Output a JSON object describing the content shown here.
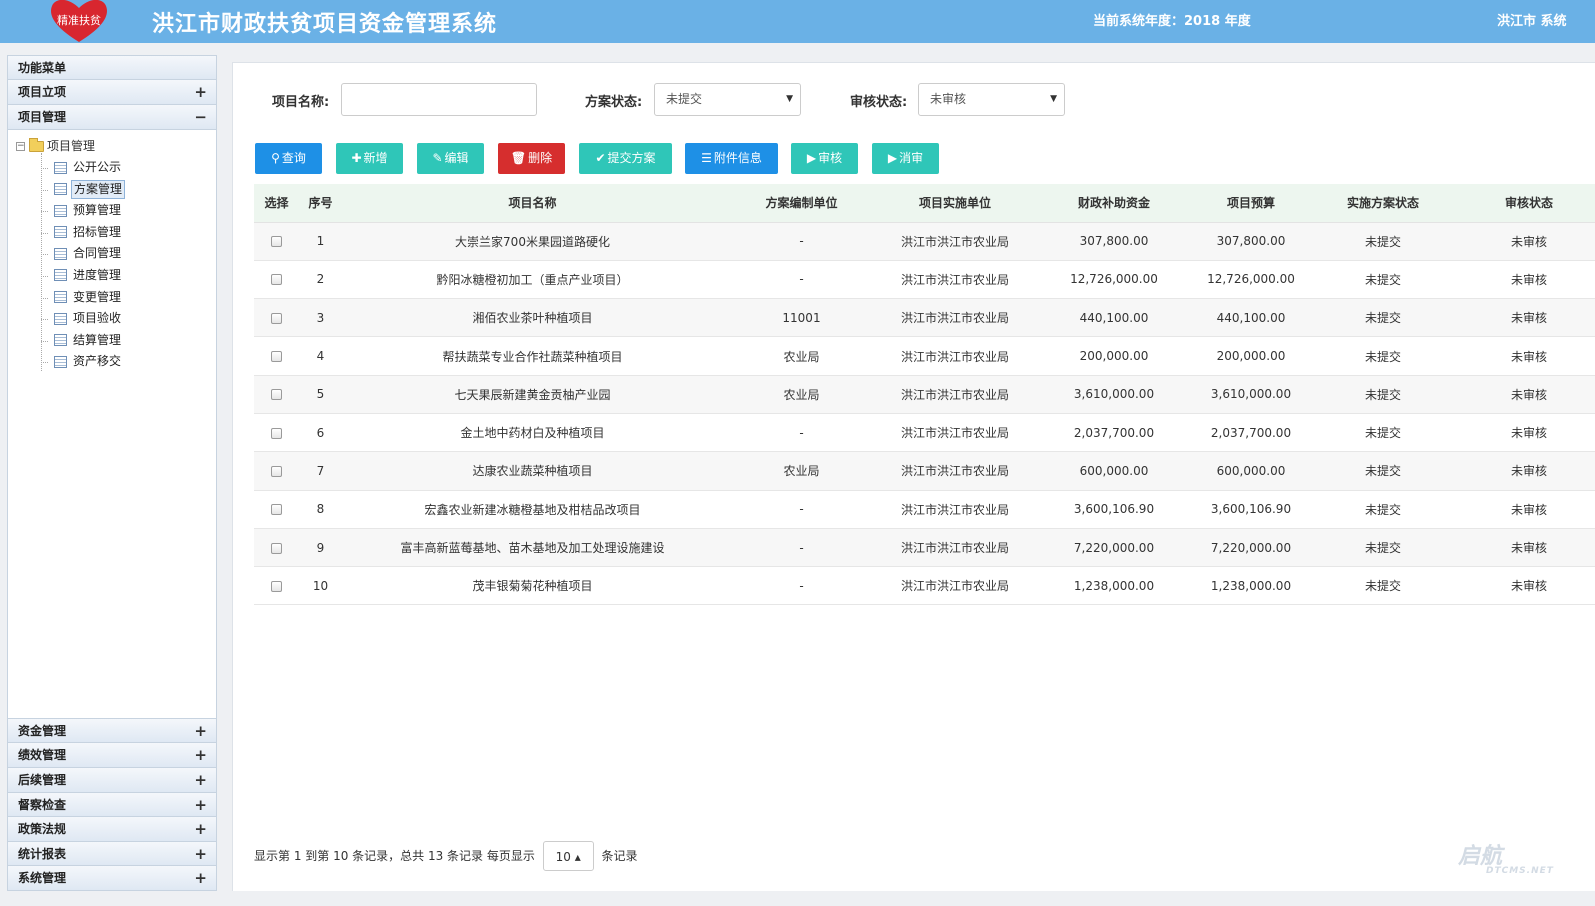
{
  "header": {
    "logo_text": "精准扶贫",
    "title": "洪江市财政扶贫项目资金管理系统",
    "year_info": "当前系统年度：2018 年度",
    "user_info": "洪江市 系统"
  },
  "sidebar": {
    "menu_title": "功能菜单",
    "top_groups": [
      {
        "label": "项目立项",
        "sign": "+"
      },
      {
        "label": "项目管理",
        "sign": "−"
      }
    ],
    "tree_root": "项目管理",
    "tree_items": [
      "公开公示",
      "方案管理",
      "预算管理",
      "招标管理",
      "合同管理",
      "进度管理",
      "变更管理",
      "项目验收",
      "结算管理",
      "资产移交"
    ],
    "selected_item": "方案管理",
    "bottom_groups": [
      {
        "label": "资金管理",
        "sign": "+"
      },
      {
        "label": "绩效管理",
        "sign": "+"
      },
      {
        "label": "后续管理",
        "sign": "+"
      },
      {
        "label": "督察检查",
        "sign": "+"
      },
      {
        "label": "政策法规",
        "sign": "+"
      },
      {
        "label": "统计报表",
        "sign": "+"
      },
      {
        "label": "系统管理",
        "sign": "+"
      }
    ]
  },
  "filters": {
    "name_label": "项目名称:",
    "name_value": "",
    "plan_status_label": "方案状态:",
    "plan_status_value": "未提交",
    "audit_status_label": "审核状态:",
    "audit_status_value": "未审核"
  },
  "toolbar": {
    "query": "查询",
    "add": "新增",
    "edit": "编辑",
    "delete": "删除",
    "submit_plan": "提交方案",
    "attachments": "附件信息",
    "audit": "审核",
    "cancel_audit": "消审"
  },
  "table": {
    "headers": [
      "选择",
      "序号",
      "项目名称",
      "方案编制单位",
      "项目实施单位",
      "财政补助资金",
      "项目预算",
      "实施方案状态",
      "审核状态"
    ],
    "rows": [
      {
        "no": "1",
        "name": "大崇兰家700米果园道路硬化",
        "plan_unit": "-",
        "impl_unit": "洪江市洪江市农业局",
        "subsidy": "307,800.00",
        "budget": "307,800.00",
        "plan_status": "未提交",
        "audit_status": "未审核"
      },
      {
        "no": "2",
        "name": "黔阳冰糖橙初加工（重点产业项目）",
        "plan_unit": "-",
        "impl_unit": "洪江市洪江市农业局",
        "subsidy": "12,726,000.00",
        "budget": "12,726,000.00",
        "plan_status": "未提交",
        "audit_status": "未审核"
      },
      {
        "no": "3",
        "name": "湘佰农业茶叶种植项目",
        "plan_unit": "11001",
        "impl_unit": "洪江市洪江市农业局",
        "subsidy": "440,100.00",
        "budget": "440,100.00",
        "plan_status": "未提交",
        "audit_status": "未审核"
      },
      {
        "no": "4",
        "name": "帮扶蔬菜专业合作社蔬菜种植项目",
        "plan_unit": "农业局",
        "impl_unit": "洪江市洪江市农业局",
        "subsidy": "200,000.00",
        "budget": "200,000.00",
        "plan_status": "未提交",
        "audit_status": "未审核"
      },
      {
        "no": "5",
        "name": "七天果辰新建黄金贡柚产业园",
        "plan_unit": "农业局",
        "impl_unit": "洪江市洪江市农业局",
        "subsidy": "3,610,000.00",
        "budget": "3,610,000.00",
        "plan_status": "未提交",
        "audit_status": "未审核"
      },
      {
        "no": "6",
        "name": "金土地中药材白及种植项目",
        "plan_unit": "-",
        "impl_unit": "洪江市洪江市农业局",
        "subsidy": "2,037,700.00",
        "budget": "2,037,700.00",
        "plan_status": "未提交",
        "audit_status": "未审核"
      },
      {
        "no": "7",
        "name": "达康农业蔬菜种植项目",
        "plan_unit": "农业局",
        "impl_unit": "洪江市洪江市农业局",
        "subsidy": "600,000.00",
        "budget": "600,000.00",
        "plan_status": "未提交",
        "audit_status": "未审核"
      },
      {
        "no": "8",
        "name": "宏鑫农业新建冰糖橙基地及柑桔品改项目",
        "plan_unit": "-",
        "impl_unit": "洪江市洪江市农业局",
        "subsidy": "3,600,106.90",
        "budget": "3,600,106.90",
        "plan_status": "未提交",
        "audit_status": "未审核"
      },
      {
        "no": "9",
        "name": "富丰高新蓝莓基地、苗木基地及加工处理设施建设",
        "plan_unit": "-",
        "impl_unit": "洪江市洪江市农业局",
        "subsidy": "7,220,000.00",
        "budget": "7,220,000.00",
        "plan_status": "未提交",
        "audit_status": "未审核"
      },
      {
        "no": "10",
        "name": "茂丰银菊菊花种植项目",
        "plan_unit": "-",
        "impl_unit": "洪江市洪江市农业局",
        "subsidy": "1,238,000.00",
        "budget": "1,238,000.00",
        "plan_status": "未提交",
        "audit_status": "未审核"
      }
    ]
  },
  "pager": {
    "summary": "显示第 1 到第 10 条记录，总共 13 条记录 每页显示",
    "page_size": "10 ▴",
    "suffix": "条记录"
  },
  "watermark": {
    "text": "启航",
    "sub": "DTCMS.NET"
  },
  "colors": {
    "header_bg": "#6ab1e6",
    "btn_blue": "#1e90e6",
    "btn_teal": "#2fc6b8",
    "btn_red": "#d62e2e",
    "logo_red": "#d8262f"
  }
}
